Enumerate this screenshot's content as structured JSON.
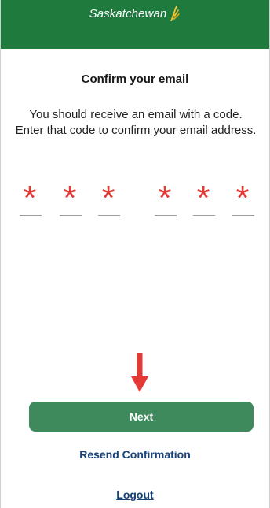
{
  "header": {
    "brand_text": "Saskatchewan",
    "background_color": "#1f7a3e",
    "logo_icon": "wheat-icon"
  },
  "title": "Confirm your email",
  "message": "You should receive an email with a code. Enter that code to confirm your email address.",
  "code": {
    "digits": [
      "*",
      "*",
      "*",
      "*",
      "*",
      "*"
    ],
    "star_color": "#e53935"
  },
  "next_label": "Next",
  "resend_label": "Resend Confirmation",
  "logout_label": "Logout",
  "colors": {
    "button": "#3f8a5d",
    "link": "#17427a",
    "arrow": "#e53935"
  }
}
